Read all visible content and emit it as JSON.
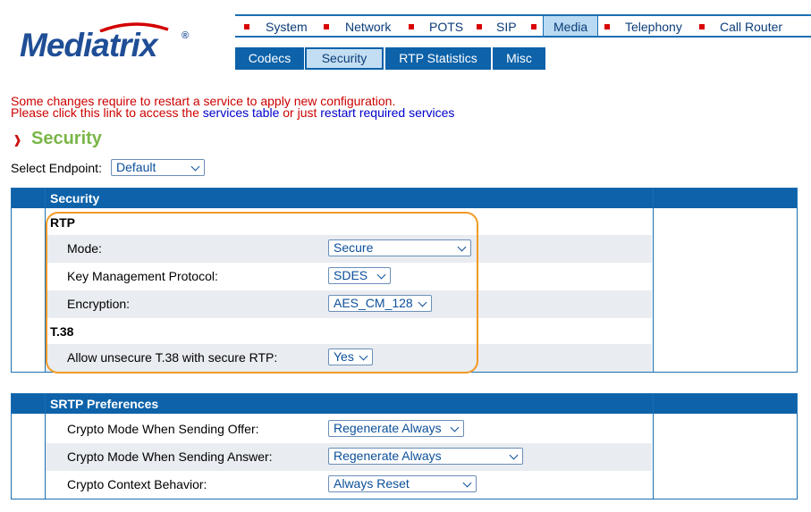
{
  "logo": {
    "text": "Mediatrix",
    "reg": "®"
  },
  "topnav": [
    "System",
    "Network",
    "POTS",
    "SIP",
    "Media",
    "Telephony",
    "Call Router"
  ],
  "topnav_active": "Media",
  "subnav": [
    "Codecs",
    "Security",
    "RTP Statistics",
    "Misc"
  ],
  "subnav_active": "Security",
  "notice": {
    "line1": "Some changes require to restart a service to apply new configuration.",
    "line2_prefix": "Please click this link to access the ",
    "services_table_link": "services table",
    "line2_middle": " or just ",
    "restart_link": "restart required services"
  },
  "page_title": "Security",
  "endpoint": {
    "label": "Select Endpoint:",
    "value": "Default"
  },
  "security_table": {
    "header": "Security",
    "rtp_group": "RTP",
    "mode_label": "Mode:",
    "mode_value": "Secure",
    "kmp_label": "Key Management Protocol:",
    "kmp_value": "SDES",
    "enc_label": "Encryption:",
    "enc_value": "AES_CM_128",
    "t38_group": "T.38",
    "t38_label": "Allow unsecure T.38 with secure RTP:",
    "t38_value": "Yes"
  },
  "srtp_table": {
    "header": "SRTP Preferences",
    "offer_label": "Crypto Mode When Sending Offer:",
    "offer_value": "Regenerate Always",
    "answer_label": "Crypto Mode When Sending Answer:",
    "answer_value": "Regenerate Always",
    "context_label": "Crypto Context Behavior:",
    "context_value": "Always Reset"
  },
  "colors": {
    "nav_blue": "#0d62a9",
    "title_green": "#7ab648",
    "notice_red": "#cc0000",
    "highlight_orange": "#f29a25"
  }
}
